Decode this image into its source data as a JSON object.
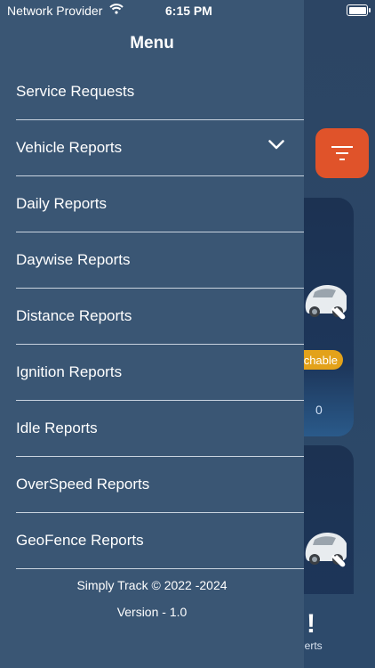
{
  "status_bar": {
    "carrier": "Network Provider",
    "time": "6:15 PM",
    "wifi_icon": "wifi-icon",
    "battery_icon": "battery-icon"
  },
  "drawer": {
    "title": "Menu",
    "items": [
      {
        "label": "Service Requests"
      },
      {
        "label": "Vehicle Reports",
        "expandable": true
      },
      {
        "label": "Daily Reports"
      },
      {
        "label": "Daywise Reports"
      },
      {
        "label": "Distance Reports"
      },
      {
        "label": "Ignition Reports"
      },
      {
        "label": "Idle Reports"
      },
      {
        "label": "OverSpeed Reports"
      },
      {
        "label": "GeoFence Reports"
      }
    ],
    "footer": {
      "copyright": "Simply Track © 2022 -2024",
      "version": "Version - 1.0"
    }
  },
  "background": {
    "filter_button_icon": "filter-icon",
    "card1": {
      "status": "chable",
      "value": "0"
    },
    "bottom_tab": {
      "icon": "!",
      "label": "lerts"
    },
    "colors": {
      "accent": "#e0532a",
      "status_pill": "#e3a21a",
      "drawer": "#3a5674"
    }
  }
}
